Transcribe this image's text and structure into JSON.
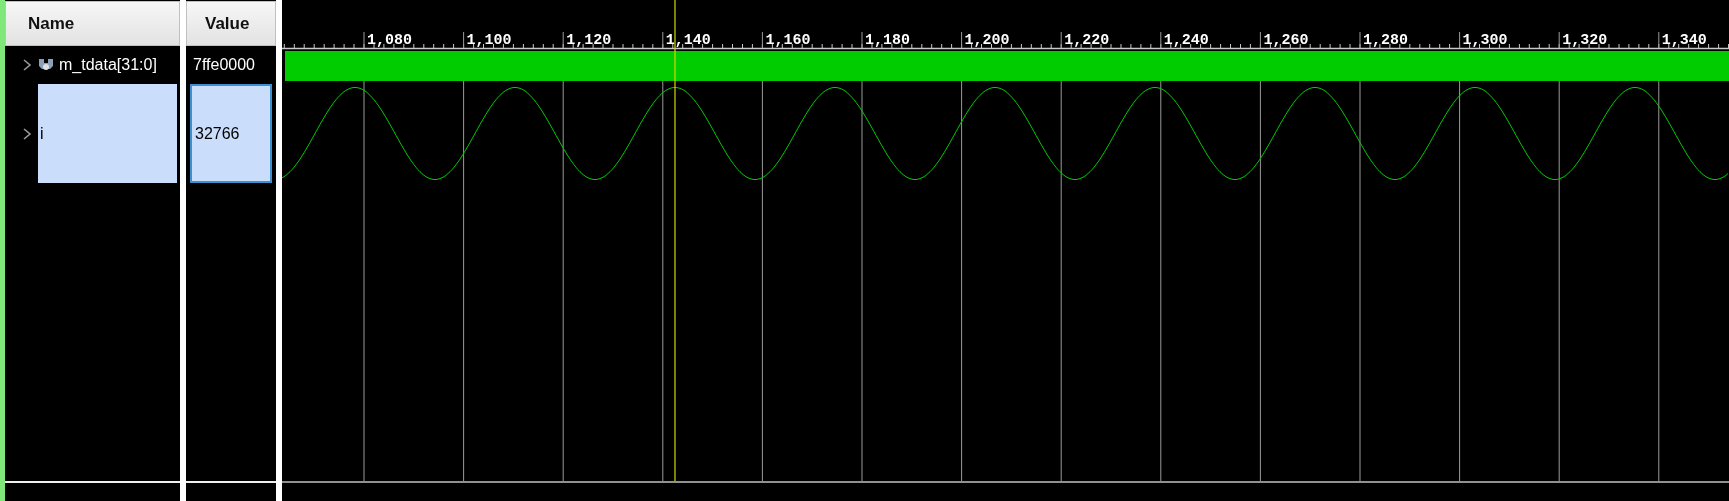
{
  "columns": [
    "Name",
    "Value"
  ],
  "signals": [
    {
      "name": "m_tdata[31:0]",
      "value": "7ffe0000",
      "kind": "bus",
      "selected": false
    },
    {
      "name": "i",
      "value": "32766",
      "kind": "analog",
      "selected": true
    }
  ],
  "ruler_labels": [
    "1,080",
    "1,100",
    "1,120",
    "1,140",
    "1,160",
    "1,180",
    "1,200",
    "1,220",
    "1,240",
    "1,260",
    "1,280",
    "1,300",
    "1,320",
    "1,340"
  ]
}
